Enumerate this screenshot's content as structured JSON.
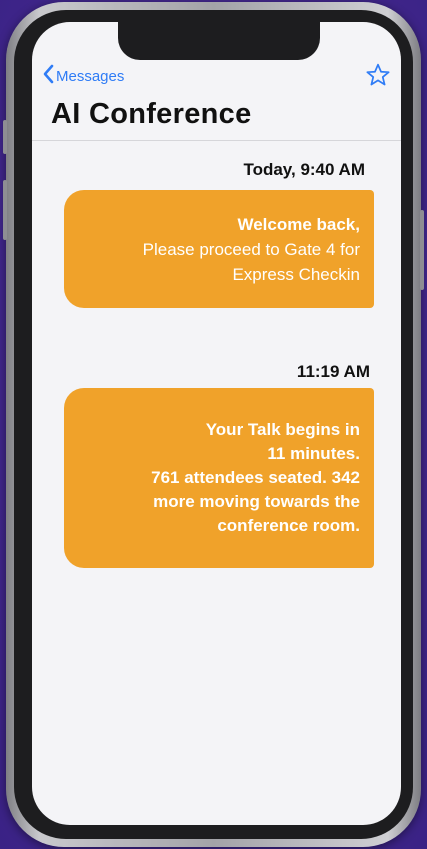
{
  "header": {
    "back_label": "Messages",
    "title": "AI Conference"
  },
  "messages": [
    {
      "time": "Today, 9:40 AM",
      "lines": [
        "Welcome back,",
        "Please proceed to Gate 4 for",
        "Express Checkin"
      ]
    },
    {
      "time": "11:19 AM",
      "lines": [
        "Your Talk begins in",
        "11 minutes.",
        "761 attendees seated. 342",
        "more moving towards the",
        "conference room."
      ]
    }
  ],
  "colors": {
    "background": "#4a2f9a",
    "bubble": "#f0a22a",
    "accent": "#2f7cf6",
    "screen": "#f4f4f7"
  },
  "icons": {
    "back": "chevron-left-icon",
    "favorite": "star-icon"
  }
}
